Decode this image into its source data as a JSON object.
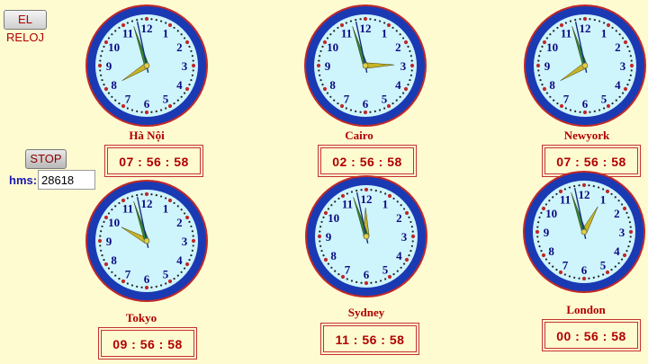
{
  "buttons": {
    "reloj": "EL RELOJ",
    "stop": "STOP"
  },
  "hms": {
    "label": "hms:",
    "value": "28618"
  },
  "clocks": [
    {
      "city": "Hà Nội",
      "time": "07 : 56 : 58",
      "hour": 7,
      "minute": 56,
      "second": 58
    },
    {
      "city": "Cairo",
      "time": "02 : 56 : 58",
      "hour": 2,
      "minute": 56,
      "second": 58
    },
    {
      "city": "Newyork",
      "time": "07 : 56 : 58",
      "hour": 7,
      "minute": 56,
      "second": 58
    },
    {
      "city": "Tokyo",
      "time": "09 : 56 : 58",
      "hour": 9,
      "minute": 56,
      "second": 58
    },
    {
      "city": "Sydney",
      "time": "11 : 56 : 58",
      "hour": 11,
      "minute": 56,
      "second": 58
    },
    {
      "city": "London",
      "time": "00 : 56 : 58",
      "hour": 0,
      "minute": 56,
      "second": 58
    }
  ],
  "dial_numbers": [
    "12",
    "1",
    "2",
    "3",
    "4",
    "5",
    "6",
    "7",
    "8",
    "9",
    "10",
    "11"
  ],
  "colors": {
    "rim": "#1a3ab4",
    "rim_edge": "#c02828",
    "face": "#cef4fc",
    "numerals": "#0a0a80",
    "hour_hand": "#c8b428",
    "minute_hand": "#2e8a3a",
    "second_hand": "#1a2a80",
    "text": "#b00000",
    "background": "#fffbd1"
  }
}
